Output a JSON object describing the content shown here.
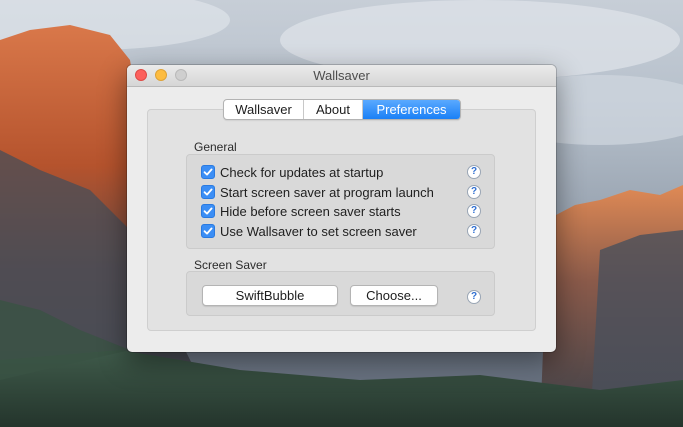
{
  "window": {
    "title": "Wallsaver"
  },
  "tabs": [
    {
      "label": "Wallsaver",
      "active": false
    },
    {
      "label": "About",
      "active": false
    },
    {
      "label": "Preferences",
      "active": true
    }
  ],
  "general": {
    "label": "General",
    "options": [
      {
        "label": "Check for updates at startup",
        "checked": true
      },
      {
        "label": "Start screen saver at program launch",
        "checked": true
      },
      {
        "label": "Hide before screen saver starts",
        "checked": true
      },
      {
        "label": "Use Wallsaver to set screen saver",
        "checked": true
      }
    ]
  },
  "screen_saver": {
    "label": "Screen Saver",
    "current_label": "SwiftBubble",
    "choose_label": "Choose..."
  },
  "help": {
    "glyph": "?"
  },
  "colors": {
    "accent": "#1a80f6",
    "close": "#fc605c",
    "minimize": "#fdbc40"
  }
}
